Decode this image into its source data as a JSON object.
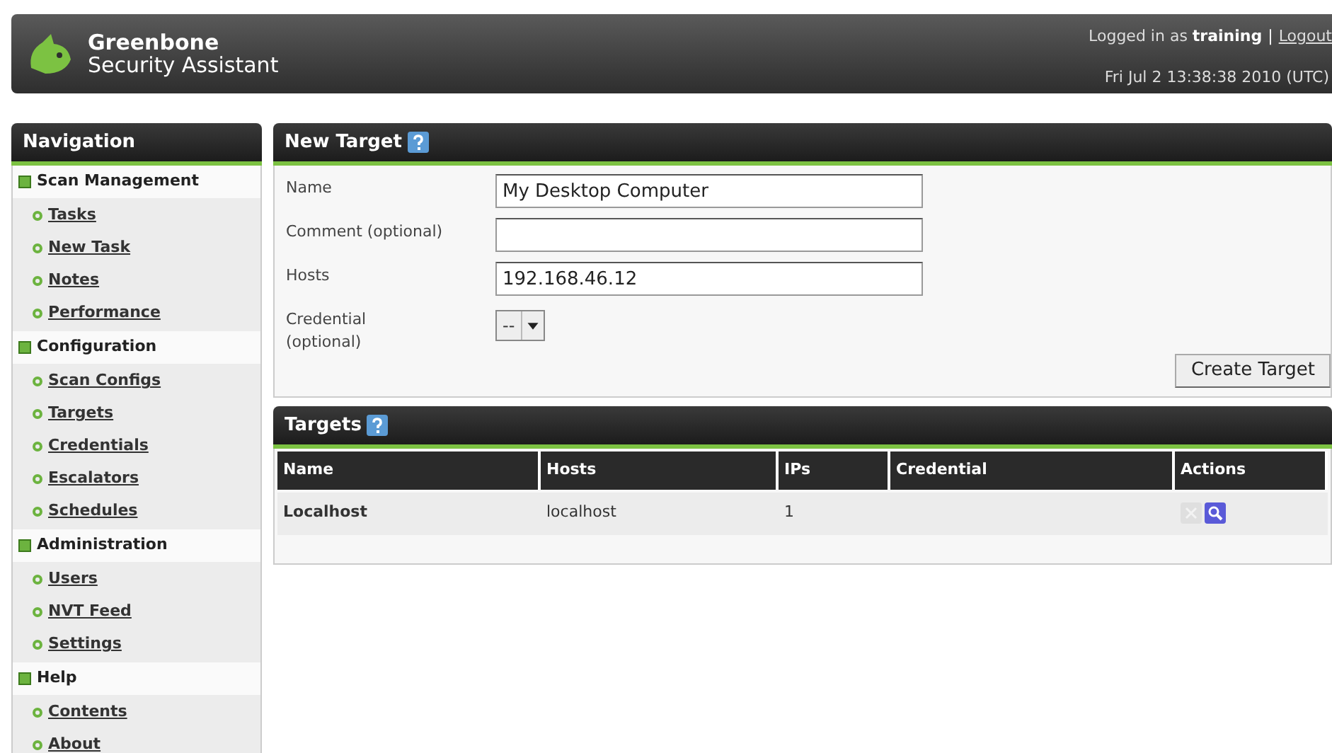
{
  "header": {
    "logo_line1": "Greenbone",
    "logo_line2": "Security Assistant",
    "login_text": "Logged in as **training**",
    "separator": "|",
    "logout": "Logout",
    "datetime": "Fri Jul 2 13:38:38 2010 (UTC)"
  },
  "navigation": {
    "title": "Navigation",
    "groups": [
      {
        "label": "Scan Management",
        "items": [
          "Tasks",
          "New Task",
          "Notes",
          "Performance"
        ]
      },
      {
        "label": "Configuration",
        "items": [
          "Scan Configs",
          "Targets",
          "Credentials",
          "Escalators",
          "Schedules"
        ]
      },
      {
        "label": "Administration",
        "items": [
          "Users",
          "NVT Feed",
          "Settings"
        ]
      },
      {
        "label": "Help",
        "items": [
          "Contents",
          "About"
        ]
      }
    ]
  },
  "new_target": {
    "title": "New Target",
    "fields": [
      {
        "kind": "text",
        "label": "Name",
        "value": "My Desktop Computer"
      },
      {
        "kind": "text",
        "label": "Comment (optional)"
      },
      {
        "kind": "text",
        "label": "Hosts",
        "value": "192.168.46.12"
      },
      {
        "kind": "select",
        "label": "Credential (optional)",
        "value": "--"
      }
    ],
    "submit": "Create Target"
  },
  "targets": {
    "title": "Targets",
    "columns": [
      "Name",
      "Hosts",
      "IPs",
      "Credential",
      "Actions"
    ],
    "rows": [
      {
        "name": "Localhost",
        "hosts": "localhost",
        "ips": "1",
        "actions": [
          {
            "kind": "delete",
            "disabled": true
          },
          {
            "kind": "details",
            "disabled": false
          }
        ]
      }
    ]
  }
}
